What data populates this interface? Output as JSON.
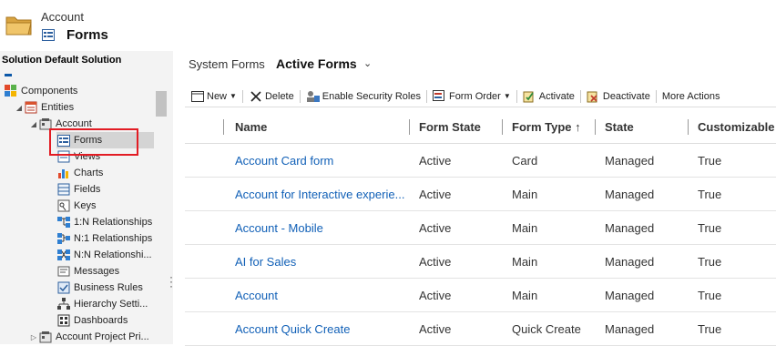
{
  "header": {
    "entity": "Account",
    "title": "Forms"
  },
  "sidebar": {
    "solution_title": "Solution Default Solution",
    "tree": [
      {
        "label": "Components",
        "icon": "components-icon",
        "arrow": ""
      },
      {
        "label": "Entities",
        "icon": "entities-icon",
        "arrow": "◢"
      },
      {
        "label": "Account",
        "icon": "account-entity-icon",
        "arrow": "◢"
      },
      {
        "label": "Forms",
        "icon": "forms-icon",
        "arrow": "",
        "selected": true
      },
      {
        "label": "Views",
        "icon": "views-icon",
        "arrow": ""
      },
      {
        "label": "Charts",
        "icon": "charts-icon",
        "arrow": ""
      },
      {
        "label": "Fields",
        "icon": "fields-icon",
        "arrow": ""
      },
      {
        "label": "Keys",
        "icon": "keys-icon",
        "arrow": ""
      },
      {
        "label": "1:N Relationships",
        "icon": "relationship-icon",
        "arrow": ""
      },
      {
        "label": "N:1 Relationships",
        "icon": "relationship-icon",
        "arrow": ""
      },
      {
        "label": "N:N Relationshi...",
        "icon": "relationship-icon",
        "arrow": ""
      },
      {
        "label": "Messages",
        "icon": "messages-icon",
        "arrow": ""
      },
      {
        "label": "Business Rules",
        "icon": "business-rules-icon",
        "arrow": ""
      },
      {
        "label": "Hierarchy Setti...",
        "icon": "hierarchy-icon",
        "arrow": ""
      },
      {
        "label": "Dashboards",
        "icon": "dashboards-icon",
        "arrow": ""
      },
      {
        "label": "Account Project Pri...",
        "icon": "account-entity-icon",
        "arrow": "▷"
      }
    ]
  },
  "view": {
    "label": "System Forms",
    "name": "Active Forms"
  },
  "toolbar": {
    "new": "New",
    "delete": "Delete",
    "enable_security_roles": "Enable Security Roles",
    "form_order": "Form Order",
    "activate": "Activate",
    "deactivate": "Deactivate",
    "more_actions": "More Actions"
  },
  "grid": {
    "columns": [
      "Name",
      "Form State",
      "Form Type ↑",
      "State",
      "Customizable"
    ],
    "rows": [
      {
        "name": "Account Card form",
        "form_state": "Active",
        "form_type": "Card",
        "state": "Managed",
        "customizable": "True"
      },
      {
        "name": "Account for Interactive experie...",
        "form_state": "Active",
        "form_type": "Main",
        "state": "Managed",
        "customizable": "True"
      },
      {
        "name": "Account - Mobile",
        "form_state": "Active",
        "form_type": "Main",
        "state": "Managed",
        "customizable": "True"
      },
      {
        "name": "AI for Sales",
        "form_state": "Active",
        "form_type": "Main",
        "state": "Managed",
        "customizable": "True"
      },
      {
        "name": "Account",
        "form_state": "Active",
        "form_type": "Main",
        "state": "Managed",
        "customizable": "True"
      },
      {
        "name": "Account Quick Create",
        "form_state": "Active",
        "form_type": "Quick Create",
        "state": "Managed",
        "customizable": "True"
      }
    ]
  },
  "colors": {
    "link": "#1160b7",
    "highlight_box": "#e21c24",
    "sidebar_bg": "#f3f3f3"
  }
}
